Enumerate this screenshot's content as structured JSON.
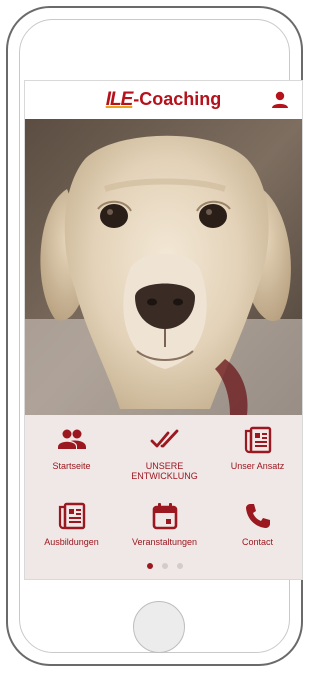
{
  "app": {
    "brand_logo": "ILE",
    "brand_name": "-Coaching",
    "brand_color": "#b5121b",
    "user_icon": "user-icon"
  },
  "hero": {
    "subject": "dog-photo"
  },
  "menu": {
    "items": [
      {
        "label": "Startseite",
        "icon": "people-icon"
      },
      {
        "label": "UNSERE\nENTWICKLUNG",
        "icon": "double-check-icon"
      },
      {
        "label": "Unser Ansatz",
        "icon": "document-icon"
      },
      {
        "label": "Ausbildungen",
        "icon": "document-icon"
      },
      {
        "label": "Veranstaltungen",
        "icon": "calendar-icon"
      },
      {
        "label": "Contact",
        "icon": "phone-icon"
      }
    ],
    "accent_color": "#9c1820",
    "panel_color": "#efe8e6"
  },
  "pager": {
    "pages": 3,
    "active": 1
  }
}
